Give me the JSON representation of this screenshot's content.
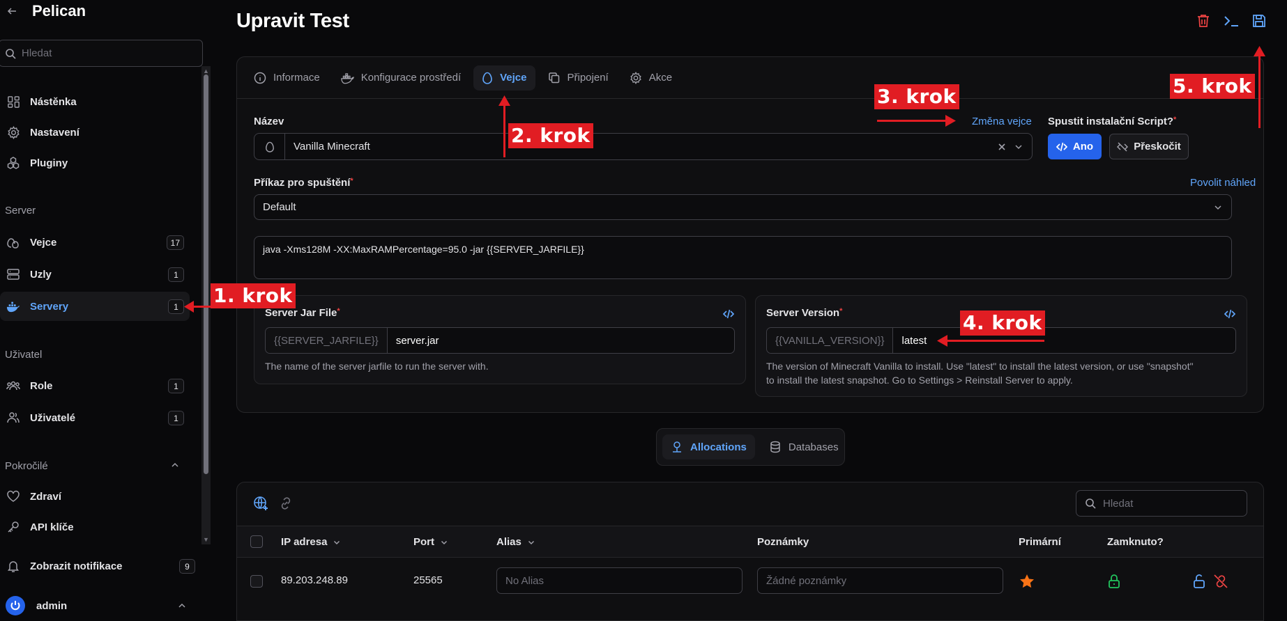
{
  "brand": {
    "name": "Pelican"
  },
  "sidebar": {
    "search_placeholder": "Hledat",
    "items": [
      {
        "label": "Nástěnka",
        "icon": "dashboard-icon"
      },
      {
        "label": "Nastavení",
        "icon": "gear-icon"
      },
      {
        "label": "Pluginy",
        "icon": "puzzle-icon"
      }
    ],
    "server_group": "Server",
    "server_items": [
      {
        "label": "Vejce",
        "badge": "17"
      },
      {
        "label": "Uzly",
        "badge": "1"
      },
      {
        "label": "Servery",
        "badge": "1",
        "active": true
      }
    ],
    "user_group": "Uživatel",
    "user_items": [
      {
        "label": "Role",
        "badge": "1"
      },
      {
        "label": "Uživatelé",
        "badge": "1"
      }
    ],
    "advanced_group": "Pokročilé",
    "advanced_items": [
      {
        "label": "Zdraví"
      },
      {
        "label": "API klíče"
      }
    ],
    "notifications": {
      "label": "Zobrazit notifikace",
      "badge": "9"
    },
    "user": {
      "name": "admin"
    }
  },
  "page": {
    "title": "Upravit Test"
  },
  "tabs": [
    "Informace",
    "Konfigurace prostředí",
    "Vejce",
    "Připojení",
    "Akce"
  ],
  "egg_form": {
    "name_label": "Název",
    "change_egg_link": "Změna vejce",
    "egg_value": "Vanilla Minecraft",
    "install_label": "Spustit instalační Script?",
    "yes_label": "Ano",
    "skip_label": "Přeskočit",
    "startup_label": "Příkaz pro spuštění",
    "preview_link": "Povolit náhled",
    "startup_select": "Default",
    "startup_command": "java -Xms128M -XX:MaxRAMPercentage=95.0 -jar {{SERVER_JARFILE}}"
  },
  "variables": [
    {
      "label": "Server Jar File",
      "prefix": "{{SERVER_JARFILE}}",
      "value": "server.jar",
      "help": "The name of the server jarfile to run the server with."
    },
    {
      "label": "Server Version",
      "prefix": "{{VANILLA_VERSION}}",
      "value": "latest",
      "help_line1": "The version of Minecraft Vanilla to install. Use \"latest\" to install the latest version, or use \"snapshot\"",
      "help_line2": "to install the latest snapshot. Go to Settings > Reinstall Server to apply."
    }
  ],
  "relation_tabs": [
    "Allocations",
    "Databases"
  ],
  "table": {
    "search_placeholder": "Hledat",
    "columns": [
      "IP adresa",
      "Port",
      "Alias",
      "Poznámky",
      "Primární",
      "Zamknuto?"
    ],
    "rows": [
      {
        "ip": "89.203.248.89",
        "port": "25565",
        "alias_placeholder": "No Alias",
        "notes_placeholder": "Žádné poznámky"
      }
    ]
  },
  "annotations": [
    "1. krok",
    "2. krok",
    "3. krok",
    "4. krok",
    "5. krok"
  ],
  "colors": {
    "accent": "#60a5fa",
    "primary": "#2563eb",
    "annotation": "#e11d23",
    "danger": "#ef4444",
    "star": "#f97316",
    "lock": "#22c55e"
  }
}
